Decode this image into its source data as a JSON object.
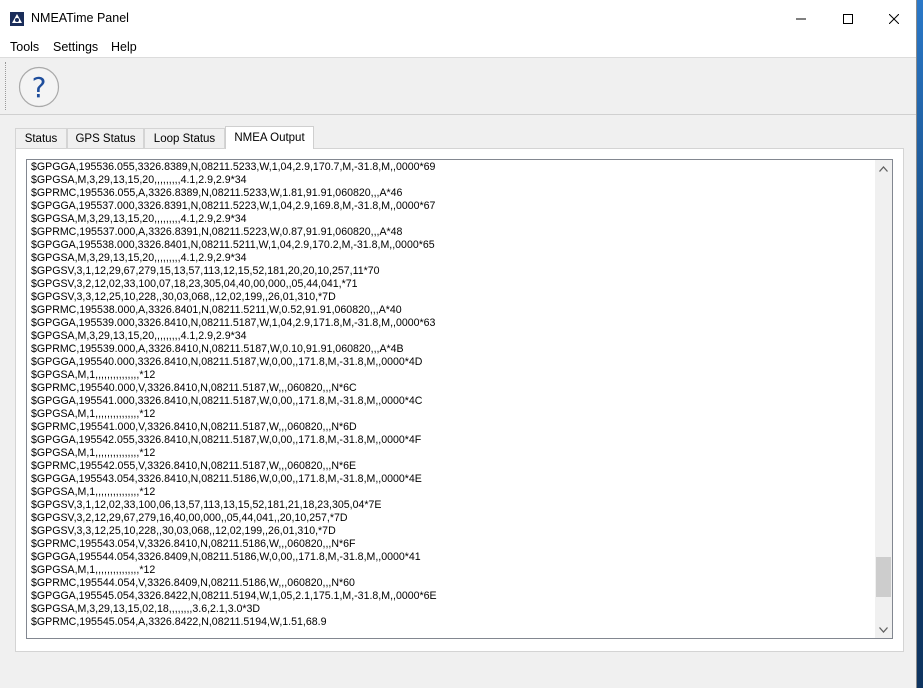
{
  "window": {
    "title": "NMEATime Panel",
    "icon": "nmeatime-app-icon"
  },
  "menu": {
    "items": [
      {
        "label": "Tools"
      },
      {
        "label": "Settings"
      },
      {
        "label": "Help"
      }
    ]
  },
  "toolbar": {
    "help_icon": "help-question-icon"
  },
  "tabs": [
    {
      "label": "Status"
    },
    {
      "label": "GPS Status"
    },
    {
      "label": "Loop Status"
    },
    {
      "label": "NMEA Output",
      "active": true
    }
  ],
  "nmea_output": {
    "scroll_position": 0.94,
    "lines": [
      "$GPGGA,195536.055,3326.8389,N,08211.5233,W,1,04,2.9,170.7,M,-31.8,M,,0000*69",
      "$GPGSA,M,3,29,13,15,20,,,,,,,,,4.1,2.9,2.9*34",
      "$GPRMC,195536.055,A,3326.8389,N,08211.5233,W,1.81,91.91,060820,,,A*46",
      "$GPGGA,195537.000,3326.8391,N,08211.5223,W,1,04,2.9,169.8,M,-31.8,M,,0000*67",
      "$GPGSA,M,3,29,13,15,20,,,,,,,,,4.1,2.9,2.9*34",
      "$GPRMC,195537.000,A,3326.8391,N,08211.5223,W,0.87,91.91,060820,,,A*48",
      "$GPGGA,195538.000,3326.8401,N,08211.5211,W,1,04,2.9,170.2,M,-31.8,M,,0000*65",
      "$GPGSA,M,3,29,13,15,20,,,,,,,,,4.1,2.9,2.9*34",
      "$GPGSV,3,1,12,29,67,279,15,13,57,113,12,15,52,181,20,20,10,257,11*70",
      "$GPGSV,3,2,12,02,33,100,07,18,23,305,04,40,00,000,,05,44,041,*71",
      "$GPGSV,3,3,12,25,10,228,,30,03,068,,12,02,199,,26,01,310,*7D",
      "$GPRMC,195538.000,A,3326.8401,N,08211.5211,W,0.52,91.91,060820,,,A*40",
      "$GPGGA,195539.000,3326.8410,N,08211.5187,W,1,04,2.9,171.8,M,-31.8,M,,0000*63",
      "$GPGSA,M,3,29,13,15,20,,,,,,,,,4.1,2.9,2.9*34",
      "$GPRMC,195539.000,A,3326.8410,N,08211.5187,W,0.10,91.91,060820,,,A*4B",
      "$GPGGA,195540.000,3326.8410,N,08211.5187,W,0,00,,171.8,M,-31.8,M,,0000*4D",
      "$GPGSA,M,1,,,,,,,,,,,,,,,*12",
      "$GPRMC,195540.000,V,3326.8410,N,08211.5187,W,,,060820,,,N*6C",
      "$GPGGA,195541.000,3326.8410,N,08211.5187,W,0,00,,171.8,M,-31.8,M,,0000*4C",
      "$GPGSA,M,1,,,,,,,,,,,,,,,*12",
      "$GPRMC,195541.000,V,3326.8410,N,08211.5187,W,,,060820,,,N*6D",
      "$GPGGA,195542.055,3326.8410,N,08211.5187,W,0,00,,171.8,M,-31.8,M,,0000*4F",
      "$GPGSA,M,1,,,,,,,,,,,,,,,*12",
      "$GPRMC,195542.055,V,3326.8410,N,08211.5187,W,,,060820,,,N*6E",
      "$GPGGA,195543.054,3326.8410,N,08211.5186,W,0,00,,171.8,M,-31.8,M,,0000*4E",
      "$GPGSA,M,1,,,,,,,,,,,,,,,*12",
      "$GPGSV,3,1,12,02,33,100,06,13,57,113,13,15,52,181,21,18,23,305,04*7E",
      "$GPGSV,3,2,12,29,67,279,16,40,00,000,,05,44,041,,20,10,257,*7D",
      "$GPGSV,3,3,12,25,10,228,,30,03,068,,12,02,199,,26,01,310,*7D",
      "$GPRMC,195543.054,V,3326.8410,N,08211.5186,W,,,060820,,,N*6F",
      "$GPGGA,195544.054,3326.8409,N,08211.5186,W,0,00,,171.8,M,-31.8,M,,0000*41",
      "$GPGSA,M,1,,,,,,,,,,,,,,,*12",
      "$GPRMC,195544.054,V,3326.8409,N,08211.5186,W,,,060820,,,N*60",
      "$GPGGA,195545.054,3326.8422,N,08211.5194,W,1,05,2.1,175.1,M,-31.8,M,,0000*6E",
      "$GPGSA,M,3,29,13,15,02,18,,,,,,,,3.6,2.1,3.0*3D",
      "$GPRMC,195545.054,A,3326.8422,N,08211.5194,W,1.51,68.9"
    ]
  }
}
